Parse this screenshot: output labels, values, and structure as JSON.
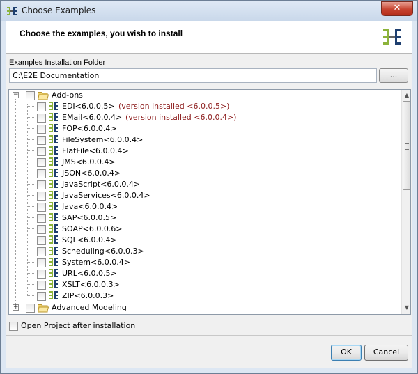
{
  "window": {
    "title": "Choose Examples",
    "close_glyph": "✕",
    "app_icon": "e2e-logo-icon"
  },
  "header": {
    "title": "Choose the examples, you wish to install",
    "logo": "e2e-logo-icon"
  },
  "folder": {
    "label": "Examples Installation Folder",
    "value": "C:\\E2E Documentation",
    "browse_label": "..."
  },
  "tree": {
    "root": {
      "label": "Add-ons",
      "expander": "−"
    },
    "items": [
      {
        "label": "EDI<6.0.0.5>",
        "note": "(version installed <6.0.0.5>)"
      },
      {
        "label": "EMail<6.0.0.4>",
        "note": "(version installed <6.0.0.4>)"
      },
      {
        "label": "FOP<6.0.0.4>",
        "note": ""
      },
      {
        "label": "FileSystem<6.0.0.4>",
        "note": ""
      },
      {
        "label": "FlatFile<6.0.0.4>",
        "note": ""
      },
      {
        "label": "JMS<6.0.0.4>",
        "note": ""
      },
      {
        "label": "JSON<6.0.0.4>",
        "note": ""
      },
      {
        "label": "JavaScript<6.0.0.4>",
        "note": ""
      },
      {
        "label": "JavaServices<6.0.0.4>",
        "note": ""
      },
      {
        "label": "Java<6.0.0.4>",
        "note": ""
      },
      {
        "label": "SAP<6.0.0.5>",
        "note": ""
      },
      {
        "label": "SOAP<6.0.0.6>",
        "note": ""
      },
      {
        "label": "SQL<6.0.0.4>",
        "note": ""
      },
      {
        "label": "Scheduling<6.0.0.3>",
        "note": ""
      },
      {
        "label": "System<6.0.0.4>",
        "note": ""
      },
      {
        "label": "URL<6.0.0.5>",
        "note": ""
      },
      {
        "label": "XSLT<6.0.0.3>",
        "note": ""
      },
      {
        "label": "ZIP<6.0.0.3>",
        "note": ""
      }
    ],
    "second_root": {
      "label": "Advanced Modeling",
      "expander": "+"
    }
  },
  "options": {
    "open_project_label": "Open Project after installation"
  },
  "buttons": {
    "ok": "OK",
    "cancel": "Cancel"
  },
  "colors": {
    "installed_note": "#8b1a1a",
    "title_bar": "#c9d8ea",
    "close_button": "#c7432f"
  }
}
